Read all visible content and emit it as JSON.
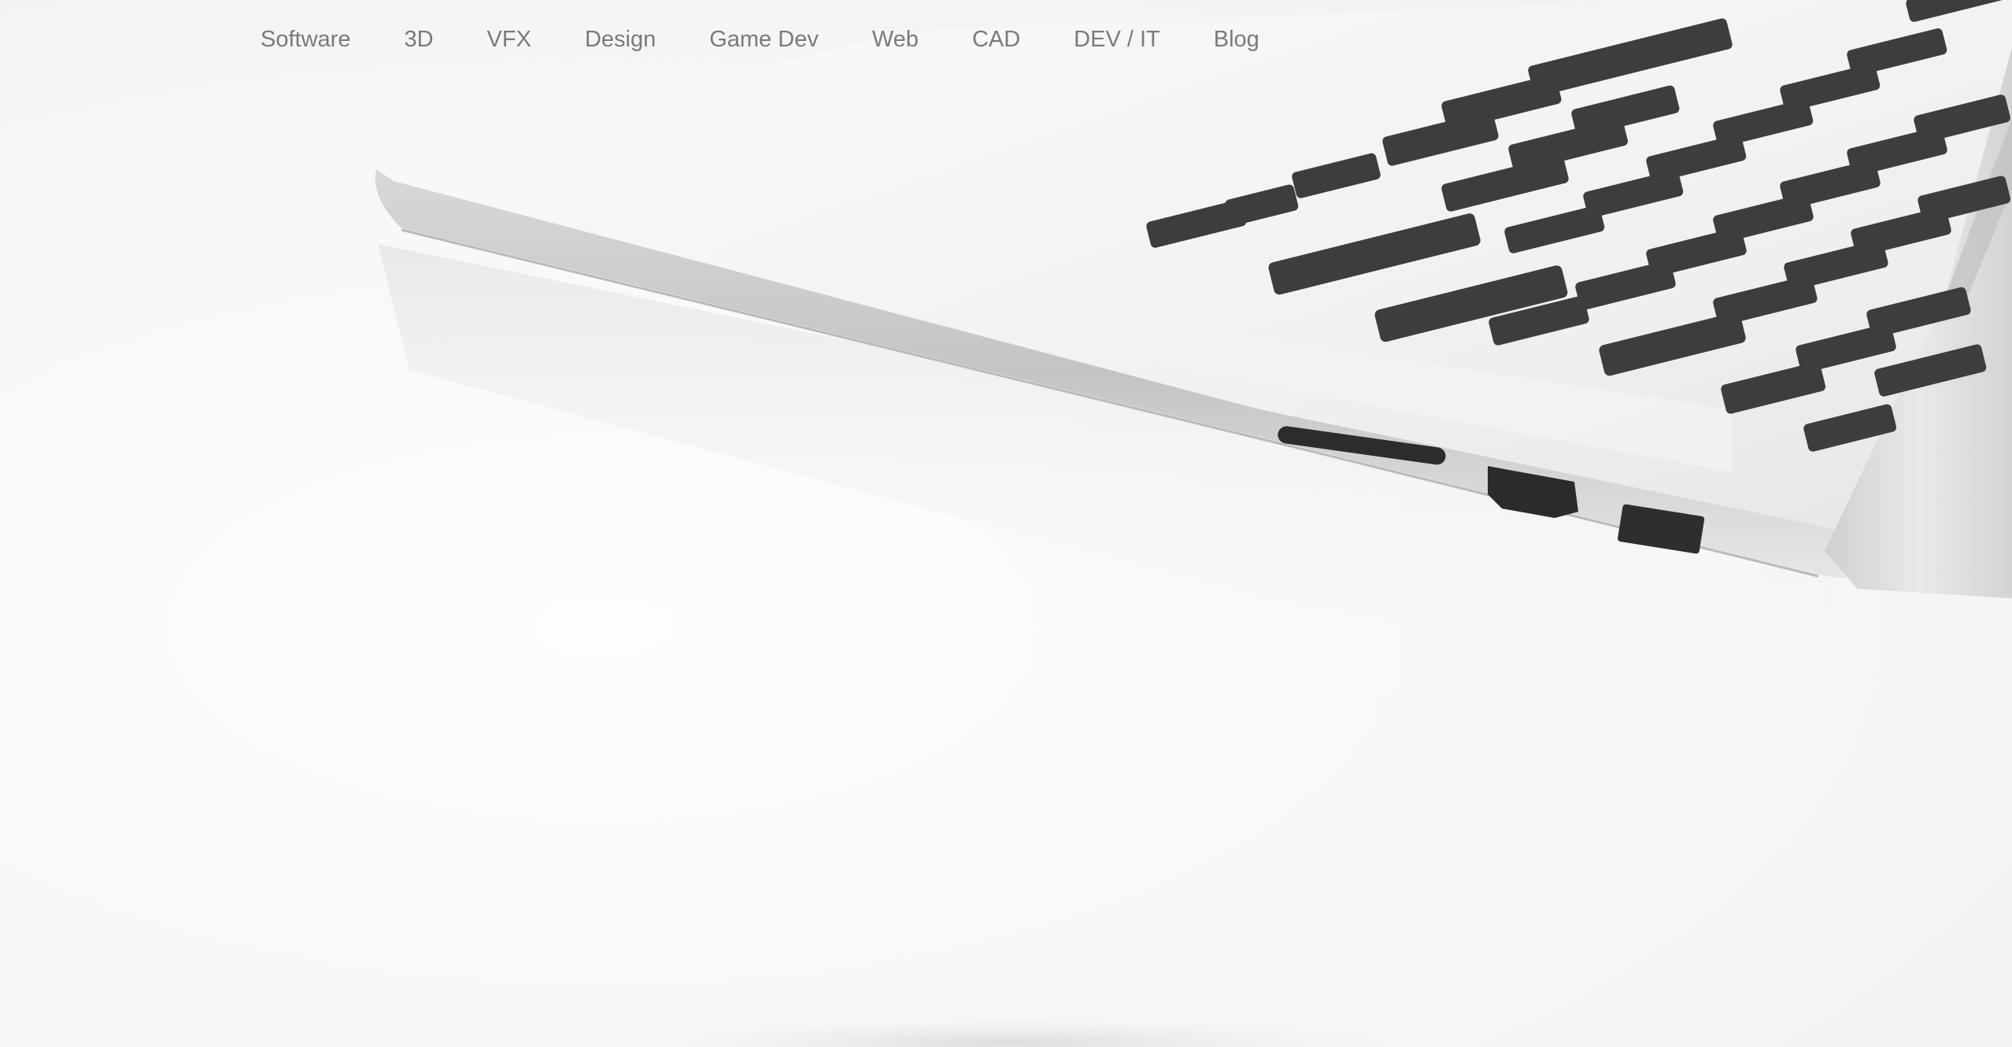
{
  "nav": {
    "items": [
      {
        "label": "Software"
      },
      {
        "label": "3D"
      },
      {
        "label": "VFX"
      },
      {
        "label": "Design"
      },
      {
        "label": "Game Dev"
      },
      {
        "label": "Web"
      },
      {
        "label": "CAD"
      },
      {
        "label": "DEV / IT"
      },
      {
        "label": "Blog"
      }
    ]
  },
  "colors": {
    "nav_text": "#7a7a7a",
    "background": "#f7f7f7",
    "laptop_body": "#e2e2e2",
    "keys": "#3c3c3c"
  }
}
